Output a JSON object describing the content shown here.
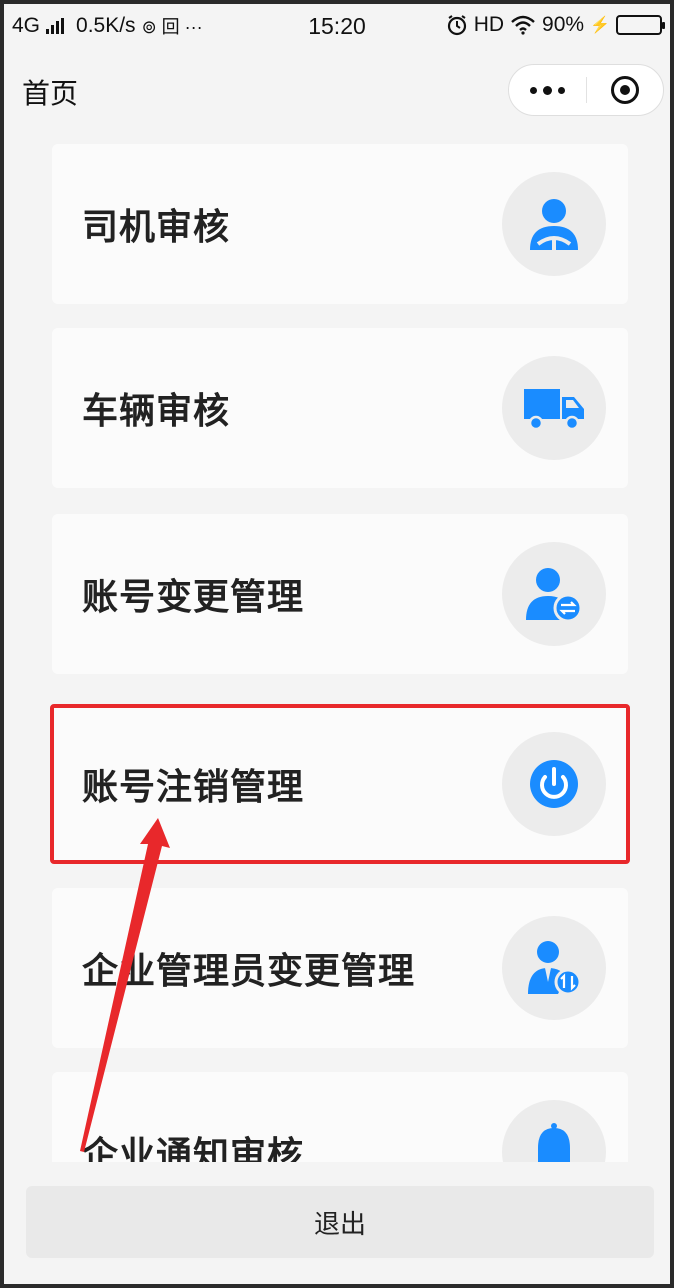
{
  "status_bar": {
    "network": "4G",
    "speed": "0.5K/s",
    "extra_glyphs": "⊚ 回 ···",
    "time": "15:20",
    "hd": "HD",
    "battery_text": "90%",
    "battery_level": 0.9
  },
  "nav": {
    "title": "首页"
  },
  "menu": {
    "items": [
      {
        "label": "司机审核",
        "icon": "driver-icon"
      },
      {
        "label": "车辆审核",
        "icon": "truck-icon"
      },
      {
        "label": "账号变更管理",
        "icon": "account-change-icon"
      },
      {
        "label": "账号注销管理",
        "icon": "power-icon"
      },
      {
        "label": "企业管理员变更管理",
        "icon": "admin-change-icon"
      },
      {
        "label": "企业通知审核",
        "icon": "bell-icon"
      }
    ]
  },
  "footer": {
    "logout_label": "退出"
  },
  "colors": {
    "accent": "#1a8cff",
    "highlight": "#e8282b",
    "background": "#f4f4f4"
  }
}
